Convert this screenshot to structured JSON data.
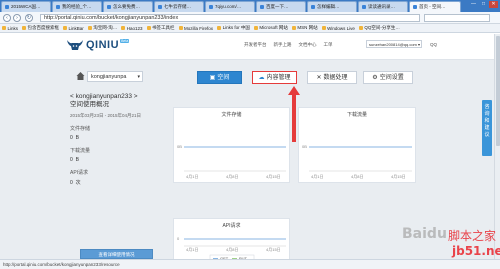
{
  "browser": {
    "tabs": [
      {
        "label": "2015WCA国…"
      },
      {
        "label": "我的经验_个…"
      },
      {
        "label": "怎么要免费…"
      },
      {
        "label": "七牛云存储…"
      },
      {
        "label": "7qiyu.com/…"
      },
      {
        "label": "百度一下…"
      },
      {
        "label": "怎样编辑…"
      },
      {
        "label": "读读通讯录…"
      },
      {
        "label": "首页 - 空间…"
      }
    ],
    "address": "http://portal.qiniu.com/bucket/kongjianyunpan233/index",
    "window_controls": [
      "—",
      "□",
      "✕"
    ],
    "bookmarks": [
      "Links",
      "包含百度搜索框",
      "LinkBar",
      "淘宝网-淘…",
      "Hao123",
      "书签工具栏",
      "Mozilla Firefox",
      "Links for 中国",
      "Microsoft 网站",
      "MSN 网站",
      "Windows Live",
      "QQ空间-分享生…"
    ],
    "status_url": "http://portal.qiniu.com/bucket/kongjianyunpan233/resource"
  },
  "header": {
    "logo_text": "QINIU",
    "logo_badge": "Beta",
    "links": [
      "开发者平台",
      "新手上路",
      "文档中心",
      "工单"
    ],
    "user_email": "sunzehan200814@qq.com",
    "qq_label": "QQ"
  },
  "toolbar": {
    "bucket": "kongjianyunpa",
    "tabs": [
      {
        "label": "空间",
        "icon": "box-icon"
      },
      {
        "label": "内容管理",
        "icon": "cloud-icon"
      },
      {
        "label": "数据处理",
        "icon": "shuffle-icon"
      },
      {
        "label": "空间设置",
        "icon": "gear-icon"
      }
    ]
  },
  "sidebar": {
    "bucket_name": "< kongjianyunpan233 >",
    "subtitle": "空间使用概况",
    "date_range": "2015年03月23日 - 2015年04月21日",
    "stats": [
      {
        "label": "文件存储",
        "value": "0",
        "unit": "B"
      },
      {
        "label": "下载流量",
        "value": "0",
        "unit": "B"
      },
      {
        "label": "API请求",
        "value": "0",
        "unit": "次"
      }
    ],
    "button": "查看详细使用情况"
  },
  "charts": {
    "storage": {
      "title": "文件存储",
      "y_tick": "0B",
      "x_ticks": [
        "4月1日",
        "4月8日",
        "4月15日"
      ]
    },
    "traffic": {
      "title": "下载流量",
      "y_tick": "0B",
      "x_ticks": [
        "4月1日",
        "4月8日",
        "4月15日"
      ]
    },
    "api": {
      "title": "API请求",
      "y_tick": "0",
      "x_ticks": [
        "4月1日",
        "4月8日",
        "4月15日"
      ],
      "legend": [
        "GET",
        "PUT"
      ]
    }
  },
  "side_rail": {
    "label": "咨询和建议"
  },
  "watermark": {
    "brand": "Baidu",
    "site": "脚本之家",
    "domain": "jb51.net"
  },
  "colors": {
    "accent": "#2e86d0",
    "highlight": "#e53b3b",
    "line": "#8ab6e3"
  }
}
